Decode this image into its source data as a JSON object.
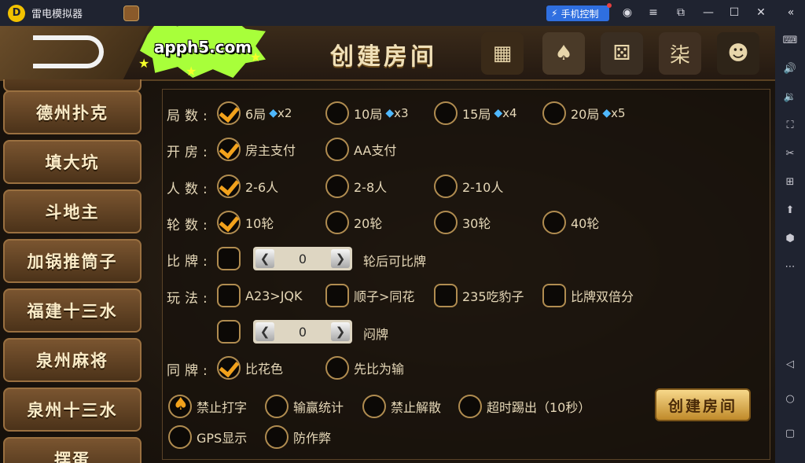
{
  "window": {
    "title": "雷电模拟器",
    "logo_glyph": "D",
    "mobile_control_label": "手机控制"
  },
  "watermark": {
    "text": "apph5.com"
  },
  "header": {
    "title": "创建房间"
  },
  "game_list": [
    {
      "label": "德州扑克"
    },
    {
      "label": "填大坑"
    },
    {
      "label": "斗地主"
    },
    {
      "label": "加锅推筒子"
    },
    {
      "label": "福建十三水"
    },
    {
      "label": "泉州麻将"
    },
    {
      "label": "泉州十三水"
    },
    {
      "label": "摆蛋"
    }
  ],
  "rows": {
    "rounds": {
      "label": "局数:",
      "options": [
        {
          "text": "6局",
          "gem_mult": "x2",
          "checked": true
        },
        {
          "text": "10局",
          "gem_mult": "x3",
          "checked": false
        },
        {
          "text": "15局",
          "gem_mult": "x4",
          "checked": false
        },
        {
          "text": "20局",
          "gem_mult": "x5",
          "checked": false
        }
      ]
    },
    "open_room": {
      "label": "开房:",
      "options": [
        {
          "text": "房主支付",
          "checked": true
        },
        {
          "text": "AA支付",
          "checked": false
        }
      ]
    },
    "players": {
      "label": "人数:",
      "options": [
        {
          "text": "2-6人",
          "checked": true
        },
        {
          "text": "2-8人",
          "checked": false
        },
        {
          "text": "2-10人",
          "checked": false
        }
      ]
    },
    "turns": {
      "label": "轮数:",
      "options": [
        {
          "text": "10轮",
          "checked": true
        },
        {
          "text": "20轮",
          "checked": false
        },
        {
          "text": "30轮",
          "checked": false
        },
        {
          "text": "40轮",
          "checked": false
        }
      ]
    },
    "compare": {
      "label": "比牌:",
      "stepper_value": "0",
      "suffix": "轮后可比牌"
    },
    "rules": {
      "label": "玩法:",
      "options": [
        {
          "text": "A23>JQK",
          "checked": false
        },
        {
          "text": "顺子>同花",
          "checked": false
        },
        {
          "text": "235吃豹子",
          "checked": false
        },
        {
          "text": "比牌双倍分",
          "checked": false
        }
      ],
      "stepper_value": "0",
      "stepper_suffix": "闷牌"
    },
    "same_cards": {
      "label": "同牌:",
      "options": [
        {
          "text": "比花色",
          "checked": true
        },
        {
          "text": "先比为输",
          "checked": false
        }
      ]
    },
    "misc": [
      {
        "text": "禁止打字",
        "checked": true
      },
      {
        "text": "输赢统计",
        "checked": false
      },
      {
        "text": "禁止解散",
        "checked": false
      },
      {
        "text": "超时踢出（10秒）",
        "checked": false
      },
      {
        "text": "GPS显示",
        "checked": false
      },
      {
        "text": "防作弊",
        "checked": false
      }
    ]
  },
  "create_button": {
    "label": "创建房间"
  },
  "icons": {
    "gem": "◆",
    "stepper_left": "❮",
    "stepper_right": "❯",
    "game_icons": [
      "四方块",
      "A♠",
      "骰子",
      "柒",
      "狮头"
    ]
  }
}
